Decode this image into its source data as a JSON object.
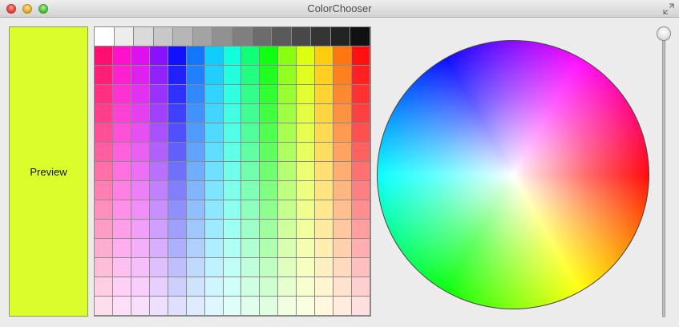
{
  "window": {
    "title": "ColorChooser"
  },
  "preview": {
    "label": "Preview",
    "color": "#dbfd2c"
  },
  "palette": {
    "grays": [
      "#ffffff",
      "#ededed",
      "#dadada",
      "#c8c8c8",
      "#b6b6b6",
      "#a3a3a3",
      "#919191",
      "#7f7f7f",
      "#6c6c6c",
      "#5a5a5a",
      "#484848",
      "#353535",
      "#232323",
      "#111111"
    ],
    "hues": [
      "#ff0f6f",
      "#ff11cc",
      "#dd11ee",
      "#8a11ff",
      "#1111ff",
      "#1177ff",
      "#11ccff",
      "#11ffdd",
      "#11ff77",
      "#11ff11",
      "#88ff11",
      "#ddff11",
      "#ffcc11",
      "#ff7711",
      "#ff1111"
    ],
    "tint_rows": 14
  },
  "wheel": {
    "label": "color-wheel"
  },
  "brightness_slider": {
    "value": 1.0
  }
}
